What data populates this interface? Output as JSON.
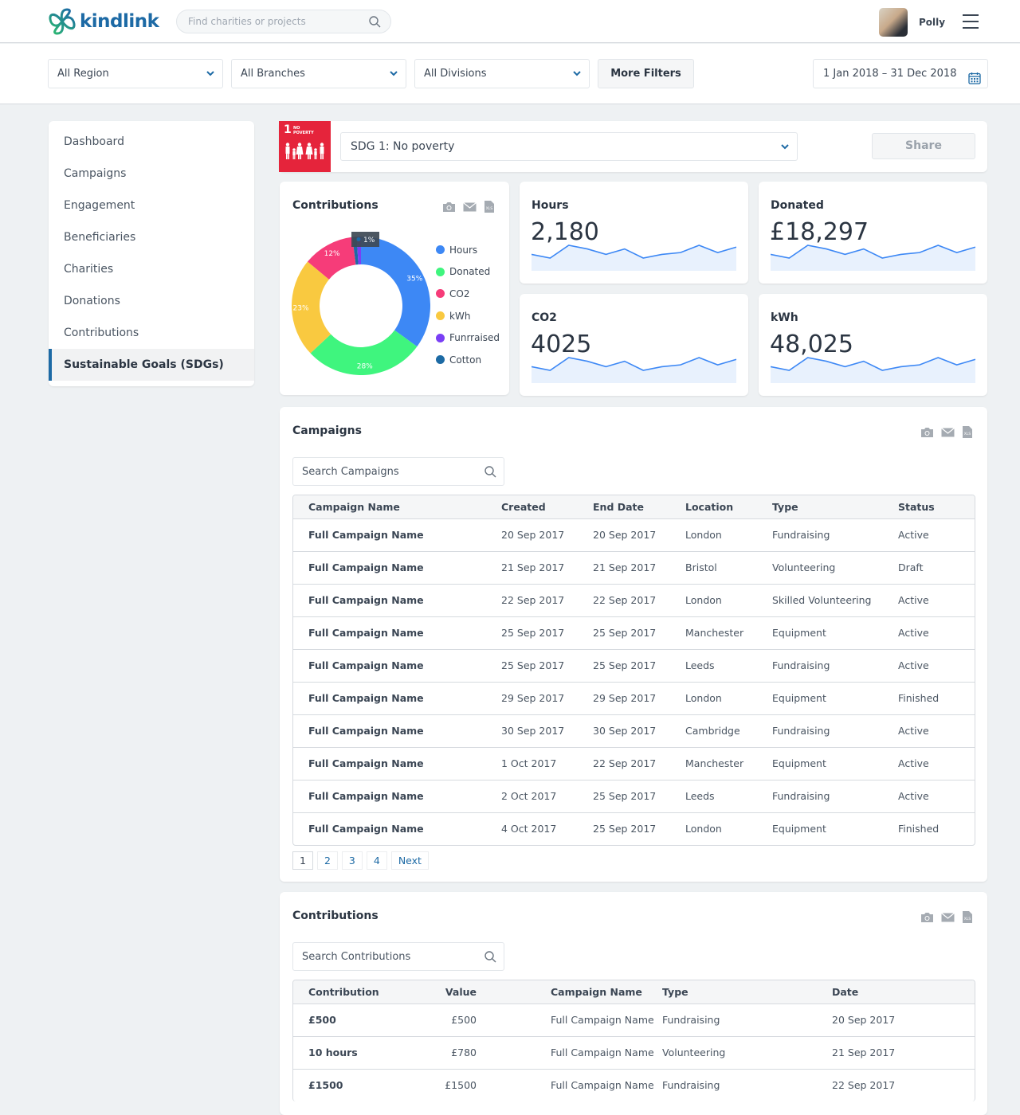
{
  "header": {
    "brand": "kindlink",
    "search_placeholder": "Find charities or projects",
    "user_name": "Polly"
  },
  "filters": {
    "region": "All Region",
    "branches": "All Branches",
    "divisions": "All Divisions",
    "more_filters_label": "More Filters",
    "date_range": "1 Jan 2018 – 31 Dec 2018"
  },
  "sidebar": {
    "items": [
      {
        "label": "Dashboard",
        "active": false
      },
      {
        "label": "Campaigns",
        "active": false
      },
      {
        "label": "Engagement",
        "active": false
      },
      {
        "label": "Beneficiaries",
        "active": false
      },
      {
        "label": "Charities",
        "active": false
      },
      {
        "label": "Donations",
        "active": false
      },
      {
        "label": "Contributions",
        "active": false
      },
      {
        "label": "Sustainable Goals (SDGs)",
        "active": true
      }
    ]
  },
  "sdg": {
    "tile_number": "1",
    "tile_label_line1": "NO",
    "tile_label_line2": "POVERTY",
    "tile_color": "#e5243b",
    "selected": "SDG 1: No poverty",
    "share_label": "Share"
  },
  "contributions_chart": {
    "title": "Contributions",
    "tooltip": "1%"
  },
  "chart_data": {
    "type": "pie",
    "variant": "donut",
    "title": "Contributions",
    "slices": [
      {
        "label": "Hours",
        "value": 35,
        "color": "#3d88f5",
        "data_label": "35%"
      },
      {
        "label": "Donated",
        "value": 28,
        "color": "#3ff57e",
        "data_label": "28%"
      },
      {
        "label": "kWh",
        "value": 23,
        "color": "#f9c940",
        "data_label": "23%"
      },
      {
        "label": "CO2",
        "value": 12,
        "color": "#f63c79",
        "data_label": "12%"
      },
      {
        "label": "Cotton",
        "value": 1,
        "color": "#1c6aa4",
        "data_label": "1%"
      },
      {
        "label": "Funrraised",
        "value": 1,
        "color": "#7a3ff5",
        "data_label": ""
      }
    ],
    "legend": [
      "Hours",
      "Donated",
      "CO2",
      "kWh",
      "Funrraised",
      "Cotton"
    ],
    "legend_colors": [
      "#3d88f5",
      "#3ff57e",
      "#f63c79",
      "#f9c940",
      "#7a3ff5",
      "#1c6aa4"
    ],
    "legend_position": "right"
  },
  "stats": [
    {
      "label": "Hours",
      "value": "2,180",
      "trend": [
        5,
        3,
        10,
        8,
        5,
        8,
        3,
        5,
        6,
        10,
        6,
        9
      ]
    },
    {
      "label": "Donated",
      "value": "£18,297",
      "trend": [
        5,
        3,
        10,
        8,
        5,
        8,
        3,
        5,
        6,
        10,
        6,
        9
      ]
    },
    {
      "label": "CO2",
      "value": "4025",
      "trend": [
        5,
        3,
        10,
        8,
        5,
        8,
        3,
        5,
        6,
        10,
        6,
        9
      ]
    },
    {
      "label": "kWh",
      "value": "48,025",
      "trend": [
        5,
        3,
        10,
        8,
        5,
        8,
        3,
        5,
        6,
        10,
        6,
        9
      ]
    }
  ],
  "campaigns": {
    "title": "Campaigns",
    "search_placeholder": "Search Campaigns",
    "columns": [
      "Campaign Name",
      "Created",
      "End Date",
      "Location",
      "Type",
      "Status"
    ],
    "rows": [
      [
        "Full Campaign Name",
        "20 Sep 2017",
        "20 Sep 2017",
        "London",
        "Fundraising",
        "Active"
      ],
      [
        "Full Campaign Name",
        "21 Sep 2017",
        "21 Sep 2017",
        "Bristol",
        "Volunteering",
        "Draft"
      ],
      [
        "Full Campaign Name",
        "22 Sep 2017",
        "22 Sep 2017",
        "London",
        "Skilled Volunteering",
        "Active"
      ],
      [
        "Full Campaign Name",
        "25 Sep 2017",
        "25 Sep 2017",
        "Manchester",
        "Equipment",
        "Active"
      ],
      [
        "Full Campaign Name",
        "25 Sep 2017",
        "25 Sep 2017",
        "Leeds",
        "Fundraising",
        "Active"
      ],
      [
        "Full Campaign Name",
        "29 Sep 2017",
        "29 Sep 2017",
        "London",
        "Equipment",
        "Finished"
      ],
      [
        "Full Campaign Name",
        "30 Sep 2017",
        "30 Sep 2017",
        "Cambridge",
        "Fundraising",
        "Active"
      ],
      [
        "Full Campaign Name",
        "1 Oct 2017",
        "22 Sep 2017",
        "Manchester",
        "Equipment",
        "Active"
      ],
      [
        "Full Campaign Name",
        "2 Oct 2017",
        "25 Sep 2017",
        "Leeds",
        "Fundraising",
        "Active"
      ],
      [
        "Full Campaign Name",
        "4 Oct 2017",
        "25 Sep 2017",
        "London",
        "Equipment",
        "Finished"
      ]
    ],
    "pagination": {
      "pages": [
        "1",
        "2",
        "3",
        "4"
      ],
      "current": "1",
      "next_label": "Next"
    }
  },
  "contributions": {
    "title": "Contributions",
    "search_placeholder": "Search Contributions",
    "columns": [
      "Contribution",
      "Value",
      "Campaign Name",
      "Type",
      "Date"
    ],
    "rows": [
      [
        "£500",
        "£500",
        "Full Campaign Name",
        "Fundraising",
        "20 Sep 2017"
      ],
      [
        "10 hours",
        "£780",
        "Full Campaign Name",
        "Volunteering",
        "21 Sep 2017"
      ],
      [
        "£1500",
        "£1500",
        "Full Campaign Name",
        "Fundraising",
        "22 Sep 2017"
      ]
    ]
  },
  "icons": {
    "camera": "camera-icon",
    "email": "email-icon",
    "xls": "xls-export-icon",
    "xls_text": "XLS"
  },
  "colors": {
    "brand_blue": "#1d6aa5",
    "brand_green": "#2bb673",
    "sparkline": "#3d88f5",
    "sparkline_fill": "#e8f1fd"
  }
}
